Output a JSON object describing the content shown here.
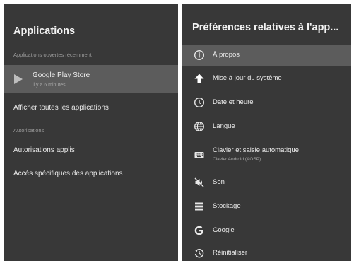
{
  "left_panel": {
    "title": "Applications",
    "recent_section": "Applications ouvertes récemment",
    "recent_app": {
      "name": "Google Play Store",
      "time": "il y a 6 minutes"
    },
    "show_all": "Afficher toutes les applications",
    "permissions_section": "Autorisations",
    "app_permissions": "Autorisations applis",
    "special_access": "Accès spécifiques des applications"
  },
  "right_panel": {
    "title": "Préférences relatives à l'app...",
    "items": [
      {
        "label": "À propos",
        "icon": "info-icon"
      },
      {
        "label": "Mise à jour du système",
        "icon": "arrow-up-icon"
      },
      {
        "label": "Date et heure",
        "icon": "clock-icon"
      },
      {
        "label": "Langue",
        "icon": "globe-icon"
      },
      {
        "label": "Clavier et saisie automatique",
        "sublabel": "Clavier Android (AOSP)",
        "icon": "keyboard-icon"
      },
      {
        "label": "Son",
        "icon": "sound-off-icon"
      },
      {
        "label": "Stockage",
        "icon": "storage-icon"
      },
      {
        "label": "Google",
        "icon": "google-icon"
      },
      {
        "label": "Réinitialiser",
        "icon": "reset-icon"
      }
    ]
  },
  "colors": {
    "panel_bg": "#383838",
    "selected_bg": "#5c5c5c",
    "text": "#e8e8e8",
    "muted": "#9a9a9a"
  }
}
